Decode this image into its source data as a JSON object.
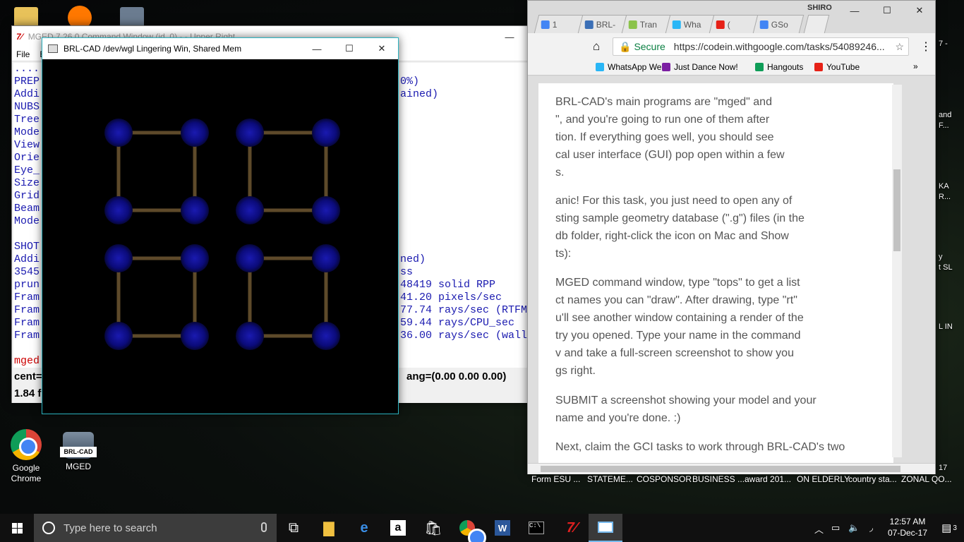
{
  "desktop": {
    "icons": [
      {
        "label": "Google\nChrome"
      },
      {
        "label": "MGED"
      }
    ],
    "side_labels": [
      "7 -",
      "and",
      "F...",
      "KA",
      "R...",
      "y",
      "t SL",
      "L IN",
      "17"
    ]
  },
  "mged": {
    "title": "MGED 7.26.0 Command Window (id_0) -  - Upper Right",
    "menu": [
      "File",
      "E"
    ],
    "left_lines": [
      "....",
      "PREP",
      "Addi",
      "NUBS",
      "Tree",
      "Mode",
      "View",
      "Orie",
      "Eye_",
      "Size",
      "Grid",
      "Beam",
      "Mode",
      "",
      "SHOT",
      "Addi",
      "3545",
      "prun",
      "Fram",
      "Fram",
      "Fram",
      "Fram",
      "",
      "mged"
    ],
    "right_lines": [
      "",
      "0%)",
      "ained)",
      "",
      "",
      "",
      "",
      "",
      "",
      "",
      "",
      "",
      "",
      "",
      "",
      "ned)",
      "ss",
      "48419 solid RPP",
      "41.20 pixels/sec",
      "77.74 rays/sec (RTFM)",
      "59.44 rays/CPU_sec",
      "36.00 rays/sec (wallclock)"
    ],
    "status": {
      "cent": "cent=",
      "ang": "ang=(0.00 0.00 0.00)",
      "fps": "1.84 f"
    }
  },
  "render": {
    "title": "BRL-CAD /dev/wgl Lingering Win, Shared Mem",
    "nodes": [
      [
        0,
        0
      ],
      [
        1,
        0
      ],
      [
        2,
        0
      ],
      [
        3,
        0
      ],
      [
        0,
        1
      ],
      [
        1,
        1
      ],
      [
        2,
        1
      ],
      [
        3,
        1
      ],
      [
        0,
        2
      ],
      [
        1,
        2
      ],
      [
        2,
        2
      ],
      [
        3,
        2
      ],
      [
        0,
        3
      ],
      [
        1,
        3
      ],
      [
        2,
        3
      ],
      [
        3,
        3
      ]
    ],
    "edges": [
      [
        0,
        1
      ],
      [
        2,
        3
      ],
      [
        4,
        5
      ],
      [
        6,
        7
      ],
      [
        8,
        9
      ],
      [
        10,
        11
      ],
      [
        12,
        13
      ],
      [
        14,
        15
      ],
      [
        0,
        4
      ],
      [
        1,
        5
      ],
      [
        2,
        6
      ],
      [
        3,
        7
      ],
      [
        8,
        12
      ],
      [
        9,
        13
      ],
      [
        10,
        14
      ],
      [
        11,
        15
      ]
    ],
    "node_color": "#0b0b8a",
    "edge_color": "#5e4a2a"
  },
  "browser": {
    "profile": "SHIRO",
    "tabs": [
      {
        "label": "1",
        "color": "#4285f4"
      },
      {
        "label": "BRL-",
        "color": "#3b6fb6"
      },
      {
        "label": "Tran",
        "color": "#8bc34a"
      },
      {
        "label": "Wha",
        "color": "#29b6f6"
      },
      {
        "label": "(",
        "color": "#e62117"
      },
      {
        "label": "GSo",
        "color": "#4285f4"
      }
    ],
    "secure": "Secure",
    "url": "https://codein.withgoogle.com/tasks/54089246...",
    "bookmarks": [
      {
        "label": "WhatsApp Web",
        "color": "#29b6f6"
      },
      {
        "label": "Just Dance Now!",
        "color": "#7b1fa2"
      },
      {
        "label": "Hangouts",
        "color": "#0f9d58"
      },
      {
        "label": "YouTube",
        "color": "#e62117"
      }
    ],
    "paragraphs": [
      "BRL-CAD's main programs are \"mged\" and\n\", and you're going to run one of them after\ntion. If everything goes well, you should see\ncal user interface (GUI) pop open within a few\ns.",
      "anic! For this task, you just need to open any of\nsting sample geometry database (\".g\") files (in the\ndb folder, right-click the icon on Mac and Show\nts):",
      "MGED command window, type \"tops\" to get a list\nct names you can \"draw\". After drawing, type \"rt\"\nu'll see another window containing a render of the\ntry you opened. Type your name in the command\nv and take a full-screen screenshot to show you\ngs right.",
      "SUBMIT a screenshot showing your model and your\nname and you're done. :)",
      "Next, claim the GCI tasks to work through BRL-CAD's two"
    ],
    "below_labels": [
      "Form  ESU ...",
      "STATEME...",
      "COSPONSOR",
      "BUSINESS ...",
      "award 201...",
      "ON ELDERLY",
      "country sta...",
      "ZONAL QO..."
    ]
  },
  "taskbar": {
    "search_placeholder": "Type here to search",
    "time": "12:57 AM",
    "date": "07-Dec-17",
    "notifications": "3"
  }
}
